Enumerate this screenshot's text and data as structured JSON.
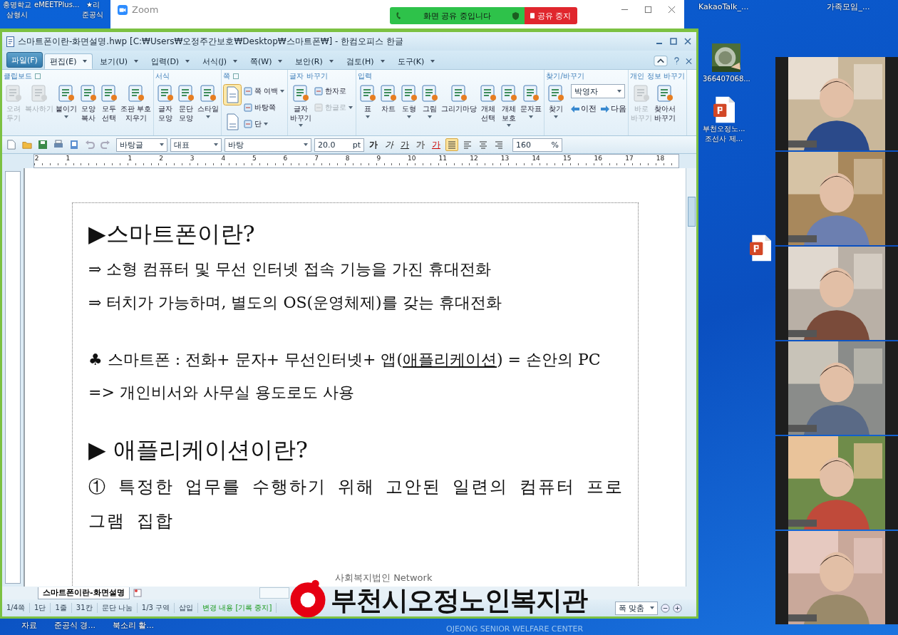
{
  "desktop_top_left": [
    {
      "lines": [
        "충명학교",
        "삼형시"
      ]
    },
    {
      "lines": [
        "eMEETPlus..."
      ]
    },
    {
      "lines": [
        "★리",
        "준공식"
      ]
    }
  ],
  "desktop_top_right": [
    "KakaoTalk_...",
    "가족모임_..."
  ],
  "desktop_icons": [
    {
      "kind": "picture",
      "lines": [
        "366407068..."
      ]
    },
    {
      "kind": "slides",
      "lines": [
        "부천오정노...",
        "조선사 제..."
      ]
    },
    {
      "kind": "slides"
    }
  ],
  "zoom_window": {
    "title": "Zoom",
    "share_status": "화면 공유 중입니다",
    "stop_share": "공유 중지"
  },
  "editor": {
    "title": "스마트폰이란-화면설명.hwp [C:₩Users₩오정주간보호₩Desktop₩스마트폰₩] - 한컴오피스 한글",
    "file_menu": "파일(F)",
    "menu_tabs": [
      {
        "label": "편집(E)",
        "kind": "menu",
        "selected": true
      },
      {
        "label": "보기(U)",
        "kind": "menu",
        "selected": false
      },
      {
        "label": "입력(D)",
        "kind": "menu",
        "selected": false
      },
      {
        "label": "서식(J)",
        "kind": "menu",
        "selected": false
      },
      {
        "label": "쪽(W)",
        "kind": "menu",
        "selected": false
      },
      {
        "label": "보안(R)",
        "kind": "menu",
        "selected": false
      },
      {
        "label": "검토(H)",
        "kind": "menu",
        "selected": false
      },
      {
        "label": "도구(K)",
        "kind": "menu",
        "selected": false
      }
    ],
    "ribbon_groups": [
      {
        "title": "클립보드",
        "launcher": true,
        "items": [
          {
            "kind": "large",
            "label": "오려\n두기",
            "disabled": true,
            "dropdown": false
          },
          {
            "kind": "large",
            "label": "복사하기",
            "disabled": true,
            "dropdown": false
          },
          {
            "kind": "large",
            "label": "붙이기",
            "disabled": false,
            "dropdown": true
          },
          {
            "kind": "large",
            "label": "모양\n복사",
            "disabled": false,
            "dropdown": false
          },
          {
            "kind": "large",
            "label": "모두\n선택",
            "disabled": false,
            "dropdown": false
          },
          {
            "kind": "large",
            "label": "조판 부호\n지우기",
            "disabled": false,
            "dropdown": false
          }
        ]
      },
      {
        "title": "서식",
        "launcher": false,
        "items": [
          {
            "kind": "large",
            "label": "글자\n모양",
            "disabled": false,
            "dropdown": false
          },
          {
            "kind": "large",
            "label": "문단\n모양",
            "disabled": false,
            "dropdown": false
          },
          {
            "kind": "large",
            "label": "스타일",
            "disabled": false,
            "dropdown": true
          }
        ]
      },
      {
        "title": "쪽",
        "launcher": true,
        "items": [
          {
            "kind": "small",
            "label": "쪽 여백",
            "disabled": false,
            "dropdown": true
          },
          {
            "kind": "small",
            "label": "바탕쪽",
            "disabled": false,
            "dropdown": false
          },
          {
            "kind": "small",
            "label": "단",
            "disabled": false,
            "dropdown": true
          }
        ]
      },
      {
        "title": "글자 바꾸기",
        "launcher": false,
        "items": [
          {
            "kind": "large",
            "label": "글자\n바꾸기",
            "disabled": false,
            "dropdown": true
          },
          {
            "kind": "small",
            "label": "한자로",
            "disabled": false,
            "dropdown": false
          },
          {
            "kind": "small",
            "label": "한글로",
            "disabled": true,
            "dropdown": true
          }
        ]
      },
      {
        "title": "입력",
        "launcher": false,
        "items": [
          {
            "kind": "large",
            "label": "표",
            "disabled": false,
            "dropdown": true
          },
          {
            "kind": "large",
            "label": "차트",
            "disabled": false,
            "dropdown": false
          },
          {
            "kind": "large",
            "label": "도형",
            "disabled": false,
            "dropdown": true
          },
          {
            "kind": "large",
            "label": "그림",
            "disabled": false,
            "dropdown": true
          },
          {
            "kind": "large",
            "label": "그리기마당",
            "disabled": false,
            "dropdown": false
          },
          {
            "kind": "large",
            "label": "개체\n선택",
            "disabled": false,
            "dropdown": false
          },
          {
            "kind": "large",
            "label": "개체\n보호",
            "disabled": false,
            "dropdown": true
          },
          {
            "kind": "large",
            "label": "문자표",
            "disabled": false,
            "dropdown": true
          }
        ]
      },
      {
        "title": "찾기/바꾸기",
        "launcher": false,
        "items": [
          {
            "kind": "large",
            "label": "찾기",
            "disabled": false,
            "dropdown": true
          },
          {
            "kind": "find",
            "value": "박영자",
            "prev": "이전",
            "next": "다음"
          }
        ]
      },
      {
        "title": "개인 정보 바꾸기",
        "launcher": false,
        "items": [
          {
            "kind": "large",
            "label": "바로\n바꾸기",
            "disabled": true,
            "dropdown": false
          },
          {
            "kind": "large",
            "label": "찾아서\n바꾸기",
            "disabled": false,
            "dropdown": false
          }
        ]
      }
    ],
    "format_bar": {
      "style": "바탕글",
      "language": "대표",
      "font": "바탕",
      "size": "20.0",
      "size_unit": "pt",
      "char_buttons": [
        "가",
        "가",
        "가",
        "가",
        "가"
      ],
      "align_buttons": [
        {
          "selected": true
        },
        {
          "selected": false
        },
        {
          "selected": false
        },
        {
          "selected": false
        }
      ],
      "line_spacing": "160",
      "spacing_unit": "%"
    },
    "ruler_numbers": [
      "2",
      "1",
      "1",
      "2",
      "3",
      "4",
      "5",
      "6",
      "7",
      "8",
      "9",
      "10",
      "11",
      "12",
      "13",
      "14",
      "15",
      "16",
      "17",
      "18"
    ],
    "document": [
      {
        "kind": "heading",
        "parts": [
          {
            "text": "▶스마트폰이란?",
            "underline": false
          }
        ]
      },
      {
        "kind": "body",
        "parts": [
          {
            "text": "⇒ 소형 컴퓨터 및 무선 인터넷 접속 기능을 가진 휴대전화",
            "underline": false
          }
        ]
      },
      {
        "kind": "body",
        "parts": [
          {
            "text": "⇒ 터치가 가능하며, 별도의 OS(운영체제)를 갖는 휴대전화",
            "underline": false
          }
        ]
      },
      {
        "kind": "spacer"
      },
      {
        "kind": "body",
        "parts": [
          {
            "text": "♣ 스마트폰 : 전화+ 문자+ 무선인터넷+ 앱(",
            "underline": false
          },
          {
            "text": "애플리케이션",
            "underline": true
          },
          {
            "text": ") = 손안의 PC",
            "underline": false
          }
        ]
      },
      {
        "kind": "body",
        "parts": [
          {
            "text": "=> 개인비서와 사무실 용도로도 사용",
            "underline": false
          }
        ]
      },
      {
        "kind": "spacer"
      },
      {
        "kind": "heading",
        "parts": [
          {
            "text": "▶ 애플리케이션이란?",
            "underline": false
          }
        ]
      },
      {
        "kind": "wrap",
        "parts": [
          {
            "text": "① 특정한 업무를 수행하기 위해 고안된 일련의 컴퓨터 프로그램 집합",
            "underline": false
          }
        ]
      }
    ],
    "sheet_tabs": [
      {
        "label": "스마트폰이란-화면설명",
        "selected": true
      }
    ],
    "status_items": [
      {
        "text": "1/4쪽",
        "kind": "plain"
      },
      {
        "text": "1단",
        "kind": "plain"
      },
      {
        "text": "1줄",
        "kind": "plain"
      },
      {
        "text": "31칸",
        "kind": "plain"
      },
      {
        "text": "문단 나눔",
        "kind": "plain"
      },
      {
        "text": "1/3 구역",
        "kind": "plain"
      },
      {
        "text": "삽입",
        "kind": "plain"
      },
      {
        "text": "변경 내용 [기록 중지]",
        "kind": "track"
      }
    ],
    "zoom_mode": "폭 맞춤"
  },
  "video_tiles": [
    {
      "kind": "picture"
    },
    {
      "kind": "picture"
    },
    {
      "kind": "picture"
    },
    {
      "kind": "picture"
    },
    {
      "kind": "picture"
    },
    {
      "kind": "picture"
    }
  ],
  "logo": {
    "org": "사회복지법인",
    "network": "Network",
    "name": "부천시오정노인복지관",
    "english": "OJEONG SENIOR WELFARE CENTER"
  },
  "taskbar_labels": [
    "자료",
    "준공식 경...",
    "북소리 활..."
  ]
}
